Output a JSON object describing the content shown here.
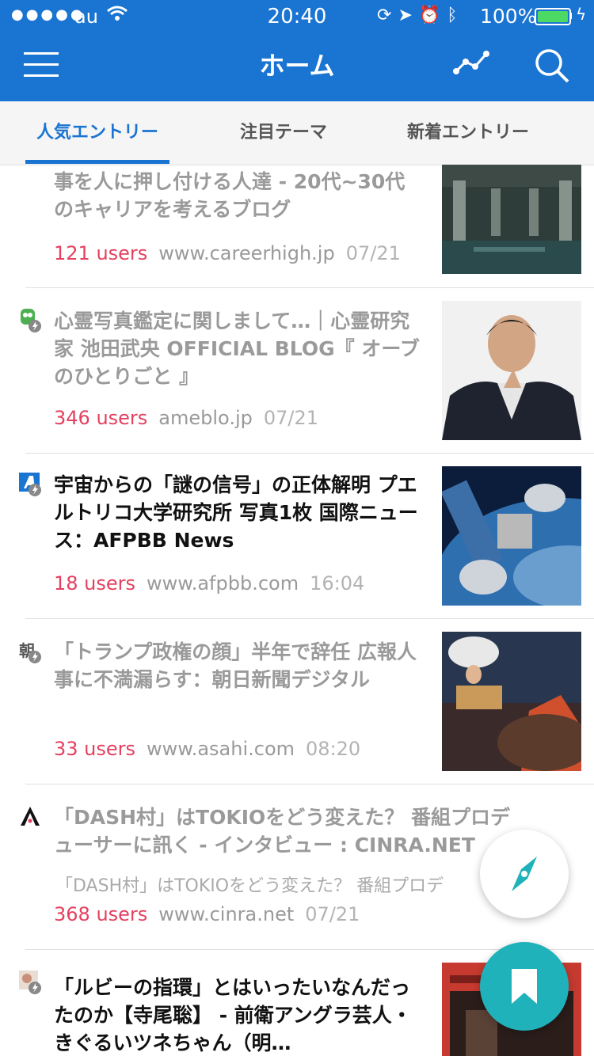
{
  "status_bar": {
    "signal": "●●●●●",
    "carrier": "au",
    "time": "20:40",
    "battery": "100%",
    "icons": [
      "rotation-lock-icon",
      "location-icon",
      "alarm-icon",
      "bluetooth-icon",
      "battery-icon",
      "charging-icon"
    ]
  },
  "nav": {
    "title": "ホーム",
    "icons": [
      "menu-icon",
      "trend-icon",
      "search-icon"
    ]
  },
  "tabs": [
    {
      "label": "人気エントリー",
      "active": true
    },
    {
      "label": "注目テーマ",
      "active": false
    },
    {
      "label": "新着エントリー",
      "active": false
    }
  ],
  "entries": [
    {
      "title": "事を人に押し付ける人達 - 20代~30代のキャリアを考えるブログ",
      "users": "121 users",
      "domain": "www.careerhigh.jp",
      "time": "07/21",
      "read": true
    },
    {
      "title": "心霊写真鑑定に関しまして…｜心霊研究家 池田武央 OFFICIAL BLOG『 オーブのひとりごと 』",
      "users": "346 users",
      "domain": "ameblo.jp",
      "time": "07/21",
      "read": true
    },
    {
      "title": "宇宙からの「謎の信号」の正体解明 プエルトリコ大学研究所 写真1枚 国際ニュース：AFPBB News",
      "users": "18 users",
      "domain": "www.afpbb.com",
      "time": "16:04",
      "read": false
    },
    {
      "title": "「トランプ政権の顔」半年で辞任 広報人事に不満漏らす：朝日新聞デジタル",
      "users": "33 users",
      "domain": "www.asahi.com",
      "time": "08:20",
      "read": true
    },
    {
      "title": "「DASH村」はTOKIOをどう変えた？ 番組プロデューサーに訊く - インタビュー : CINRA.NET",
      "description": "「DASH村」はTOKIOをどう変えた？ 番組プロデ",
      "users": "368 users",
      "domain": "www.cinra.net",
      "time": "07/21",
      "read": true
    },
    {
      "title": "「ルビーの指環」とはいったいなんだったのか【寺尾聡】 - 前衛アングラ芸人・きぐるいツネちゃん（明…",
      "read": false
    }
  ],
  "favicon_text": {
    "asahi": "朝"
  },
  "fab": {
    "explore": "compass-icon",
    "bookmark": "bookmark-icon"
  },
  "colors": {
    "header": "#1A74D2",
    "users": "#E5405F",
    "fab": "#20B2BA",
    "battery": "#4CD964"
  }
}
